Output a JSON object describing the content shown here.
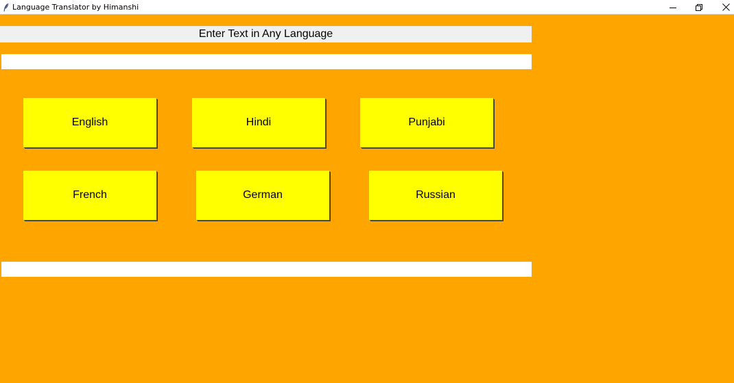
{
  "window": {
    "title": "Language Translator by Himanshi",
    "icon": "feather-icon",
    "controls": [
      "minimize-icon",
      "restore-icon",
      "close-icon"
    ]
  },
  "colors": {
    "background": "#ffa500",
    "button": "#ffff00",
    "label_background": "#f0f0f0",
    "field_background": "#ffffff"
  },
  "prompt_label": "Enter Text in Any Language",
  "input_field": {
    "value": "",
    "placeholder": ""
  },
  "output_field": {
    "value": "",
    "placeholder": ""
  },
  "buttons": {
    "english": "English",
    "hindi": "Hindi",
    "punjabi": "Punjabi",
    "french": "French",
    "german": "German",
    "russian": "Russian"
  }
}
